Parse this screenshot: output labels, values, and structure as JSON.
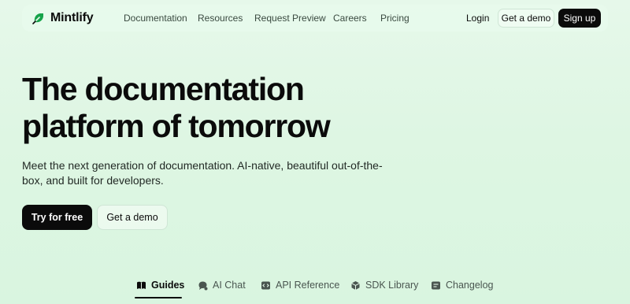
{
  "brand": {
    "name": "Mintlify",
    "accent": "#16a34a"
  },
  "nav": {
    "links": [
      "Documentation",
      "Resources",
      "Request Preview",
      "Careers",
      "Pricing"
    ],
    "login": "Login",
    "demo": "Get a demo",
    "signup": "Sign up"
  },
  "hero": {
    "headline_line1": "The documentation",
    "headline_line2": "platform of tomorrow",
    "subtext": "Meet the next generation of documentation. AI-native, beautiful out-of-the-box, and built for developers.",
    "primary_cta": "Try for free",
    "secondary_cta": "Get a demo"
  },
  "tabs": [
    {
      "label": "Guides",
      "icon": "book-icon",
      "active": true
    },
    {
      "label": "AI Chat",
      "icon": "chat-icon",
      "active": false
    },
    {
      "label": "API Reference",
      "icon": "code-icon",
      "active": false
    },
    {
      "label": "SDK Library",
      "icon": "cube-icon",
      "active": false
    },
    {
      "label": "Changelog",
      "icon": "list-icon",
      "active": false
    }
  ]
}
